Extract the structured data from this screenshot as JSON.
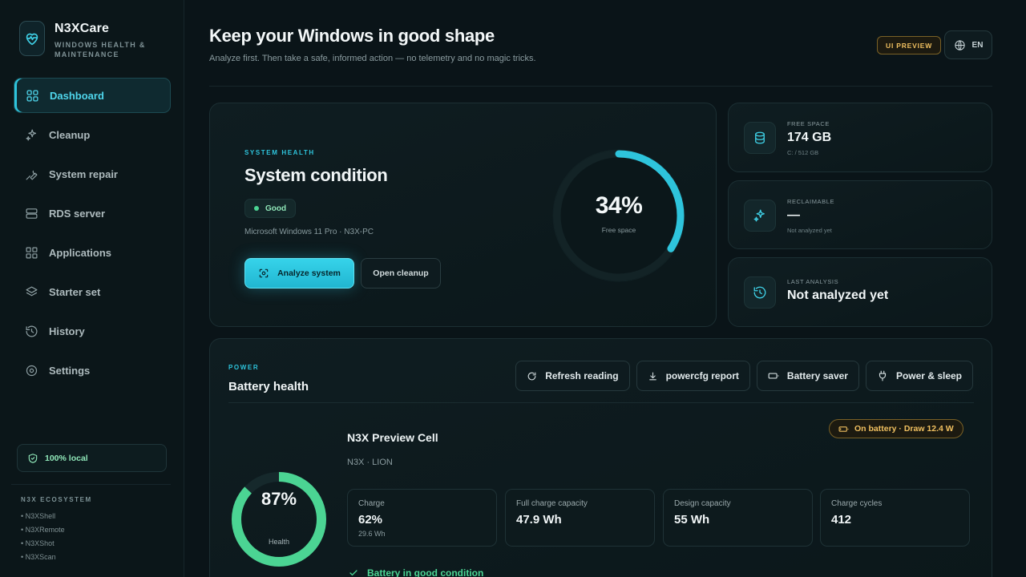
{
  "brand": {
    "name": "N3XCare",
    "subtitle": "WINDOWS HEALTH & MAINTENANCE"
  },
  "sidebar": {
    "items": [
      {
        "label": "Dashboard",
        "icon": "grid-icon",
        "active": true
      },
      {
        "label": "Cleanup",
        "icon": "sparkles-icon"
      },
      {
        "label": "System repair",
        "icon": "wrench-icon"
      },
      {
        "label": "RDS server",
        "icon": "server-icon"
      },
      {
        "label": "Applications",
        "icon": "apps-icon"
      },
      {
        "label": "Starter set",
        "icon": "layers-icon"
      },
      {
        "label": "History",
        "icon": "history-icon"
      },
      {
        "label": "Settings",
        "icon": "gear-icon"
      }
    ],
    "local_badge": "100% local",
    "ecosystem_title": "N3X ECOSYSTEM",
    "ecosystem_items": [
      "• N3XShell",
      "• N3XRemote",
      "• N3XShot",
      "• N3XScan"
    ]
  },
  "header": {
    "title": "Keep your Windows in good shape",
    "subtitle": "Analyze first. Then take a safe, informed action — no telemetry and no magic tricks.",
    "preview_badge": "UI PREVIEW",
    "language": "EN"
  },
  "health": {
    "section": "SYSTEM HEALTH",
    "title": "System condition",
    "status": "Good",
    "os_line": "Microsoft Windows 11 Pro · N3X-PC",
    "analyze_button": "Analyze system",
    "cleanup_button": "Open cleanup",
    "gauge_value": "34%",
    "gauge_fraction": 0.34,
    "gauge_label": "Free space"
  },
  "stats": {
    "free_space": {
      "label": "FREE SPACE",
      "value": "174 GB",
      "sub": "C: / 512 GB"
    },
    "reclaimable": {
      "label": "RECLAIMABLE",
      "value": "—",
      "sub": "Not analyzed yet"
    },
    "last_analysis": {
      "label": "LAST ANALYSIS",
      "value": "Not analyzed yet"
    }
  },
  "power": {
    "section": "POWER",
    "title": "Battery health",
    "actions": [
      "Refresh reading",
      "powercfg report",
      "Battery saver",
      "Power & sleep"
    ],
    "health_value": "87%",
    "health_fraction": 0.87,
    "health_label": "Health",
    "cell_name": "N3X Preview Cell",
    "cell_chem": "N3X · LION",
    "draw_status": "On battery · Draw 12.4 W",
    "metrics": [
      {
        "label": "Charge",
        "value": "62%",
        "sub": "29.6 Wh"
      },
      {
        "label": "Full charge capacity",
        "value": "47.9 Wh",
        "sub": ""
      },
      {
        "label": "Design capacity",
        "value": "55 Wh",
        "sub": ""
      },
      {
        "label": "Charge cycles",
        "value": "412",
        "sub": ""
      }
    ],
    "condition": "Battery in good condition"
  },
  "colors": {
    "accent": "#2ec4dc",
    "good": "#4bd493",
    "warning": "#f0c060",
    "background": "#0a1418"
  }
}
